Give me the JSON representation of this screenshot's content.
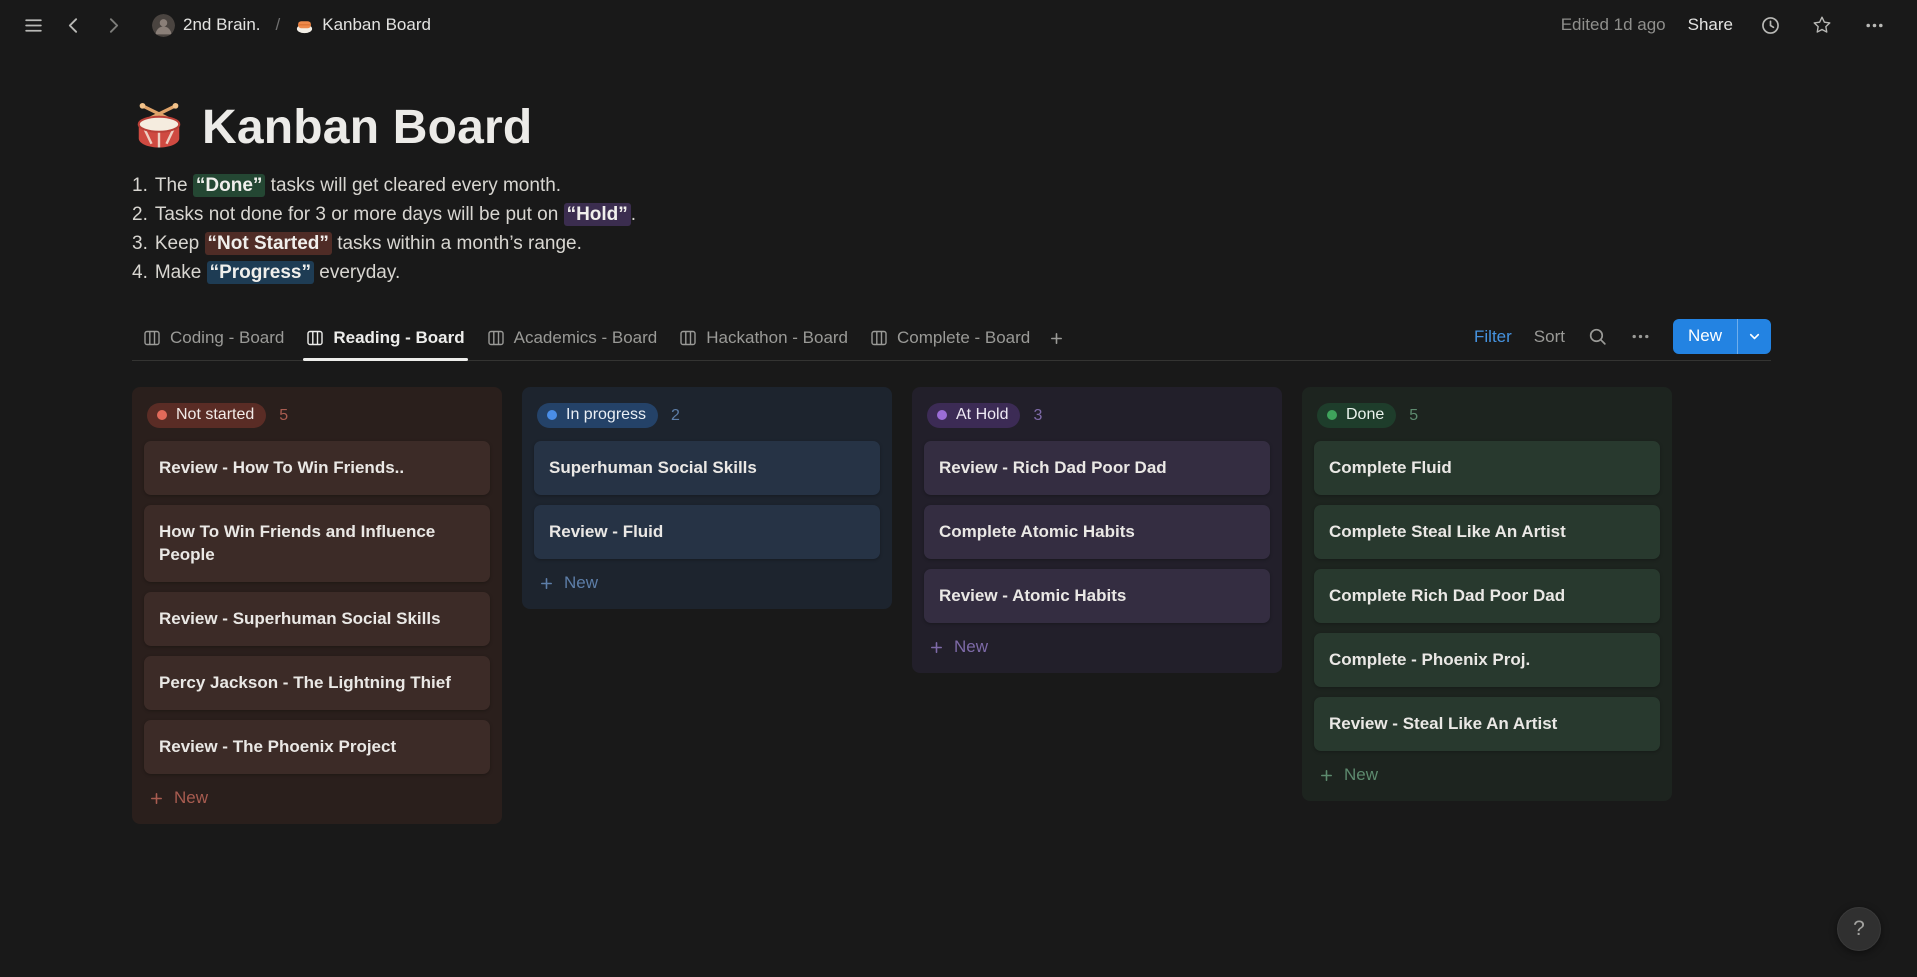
{
  "topbar": {
    "workspace": "2nd Brain.",
    "separator": "/",
    "page": "Kanban Board",
    "edited": "Edited 1d ago",
    "share": "Share"
  },
  "page": {
    "title": "Kanban Board",
    "rules": [
      {
        "number": "1.",
        "segments": [
          {
            "text": "The "
          },
          {
            "text": "“Done”",
            "hl": "green"
          },
          {
            "text": " tasks will get cleared every month."
          }
        ]
      },
      {
        "number": "2.",
        "segments": [
          {
            "text": "Tasks not done for 3 or more days will be put on "
          },
          {
            "text": "“Hold”",
            "hl": "purple"
          },
          {
            "text": "."
          }
        ]
      },
      {
        "number": "3.",
        "segments": [
          {
            "text": "Keep "
          },
          {
            "text": "“Not Started”",
            "hl": "red"
          },
          {
            "text": " tasks within a month’s range."
          }
        ]
      },
      {
        "number": "4.",
        "segments": [
          {
            "text": "Make "
          },
          {
            "text": "“Progress”",
            "hl": "blue"
          },
          {
            "text": " everyday."
          }
        ]
      }
    ]
  },
  "views": {
    "tabs": [
      {
        "label": "Coding - Board",
        "active": false
      },
      {
        "label": "Reading - Board",
        "active": true
      },
      {
        "label": "Academics - Board",
        "active": false
      },
      {
        "label": "Hackathon - Board",
        "active": false
      },
      {
        "label": "Complete - Board",
        "active": false
      }
    ]
  },
  "toolbar": {
    "filter": "Filter",
    "sort": "Sort",
    "new": "New"
  },
  "board": {
    "columns": [
      {
        "status": "Not started",
        "count": "5",
        "new_label": "New",
        "theme": {
          "dot": "#e16a5a",
          "badge_bg": "#5a2c25",
          "badge_text": "#f2ebe8",
          "column_bg": "#2a1f1c",
          "card_bg": "#3c2b27",
          "accent": "#a85c50"
        },
        "cards": [
          "Review - How To Win Friends..",
          "How To Win Friends and Influence People",
          "Review - Superhuman Social Skills",
          "Percy Jackson - The Lightning Thief",
          "Review - The Phoenix Project"
        ]
      },
      {
        "status": "In progress",
        "count": "2",
        "new_label": "New",
        "theme": {
          "dot": "#4a8ee8",
          "badge_bg": "#244268",
          "badge_text": "#eaeff5",
          "column_bg": "#1d242e",
          "card_bg": "#263345",
          "accent": "#5d7ea8"
        },
        "cards": [
          "Superhuman Social Skills",
          "Review - Fluid"
        ]
      },
      {
        "status": "At Hold",
        "count": "3",
        "new_label": "New",
        "theme": {
          "dot": "#9b6dd7",
          "badge_bg": "#3c2b55",
          "badge_text": "#efeaf5",
          "column_bg": "#221f2a",
          "card_bg": "#342d41",
          "accent": "#7e6aa8"
        },
        "cards": [
          "Review - Rich Dad Poor Dad",
          "Complete Atomic Habits",
          "Review - Atomic Habits"
        ]
      },
      {
        "status": "Done",
        "count": "5",
        "new_label": "New",
        "theme": {
          "dot": "#3fa35c",
          "badge_bg": "#1e3d2b",
          "badge_text": "#e9f2ec",
          "column_bg": "#1d241f",
          "card_bg": "#28392e",
          "accent": "#5d8a6e"
        },
        "cards": [
          "Complete Fluid",
          "Complete Steal Like An Artist",
          "Complete Rich Dad Poor Dad",
          "Complete - Phoenix Proj.",
          "Review - Steal Like An Artist"
        ]
      }
    ]
  },
  "help": {
    "label": "?"
  },
  "colors": {
    "accent_blue": "#2383e2",
    "highlights": {
      "green": "#244733",
      "purple": "#3b2d4f",
      "red": "#4f2c26",
      "blue": "#1e3c54"
    }
  },
  "icons": {
    "menu": "hamburger-icon",
    "back": "arrow-left-icon",
    "forward": "arrow-right-icon",
    "workspace": "avatar-icon",
    "page_emoji": "sushi-icon",
    "title_emoji": "drum-icon",
    "history": "clock-icon",
    "favorite": "star-icon",
    "more": "ellipsis-icon",
    "search": "magnifier-icon",
    "tab": "board-view-icon",
    "add": "plus-icon",
    "new_dropdown": "chevron-down-icon",
    "help": "question-mark-icon"
  }
}
